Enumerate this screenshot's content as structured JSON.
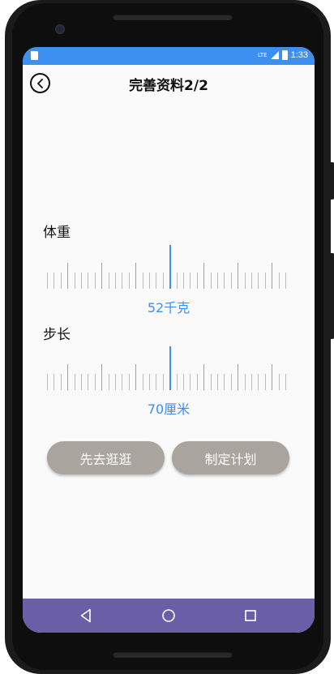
{
  "status_bar": {
    "network": "LTE",
    "time": "1:33",
    "icons": [
      "sim-icon",
      "signal-icon",
      "battery-icon"
    ]
  },
  "app_bar": {
    "title": "完善资料2/2",
    "back_icon": "back-arrow-icon"
  },
  "weight": {
    "label": "体重",
    "value_text": "52千克"
  },
  "stride": {
    "label": "步长",
    "value_text": "70厘米"
  },
  "actions": {
    "browse_label": "先去逛逛",
    "plan_label": "制定计划"
  },
  "nav_bar": {
    "icons": [
      "nav-back-icon",
      "nav-home-icon",
      "nav-recent-icon"
    ]
  },
  "colors": {
    "accent": "#3d8ff0",
    "button_bg": "#a9a59e",
    "nav_bar_bg": "#6a5fa6",
    "screen_bg": "#fafafa"
  }
}
